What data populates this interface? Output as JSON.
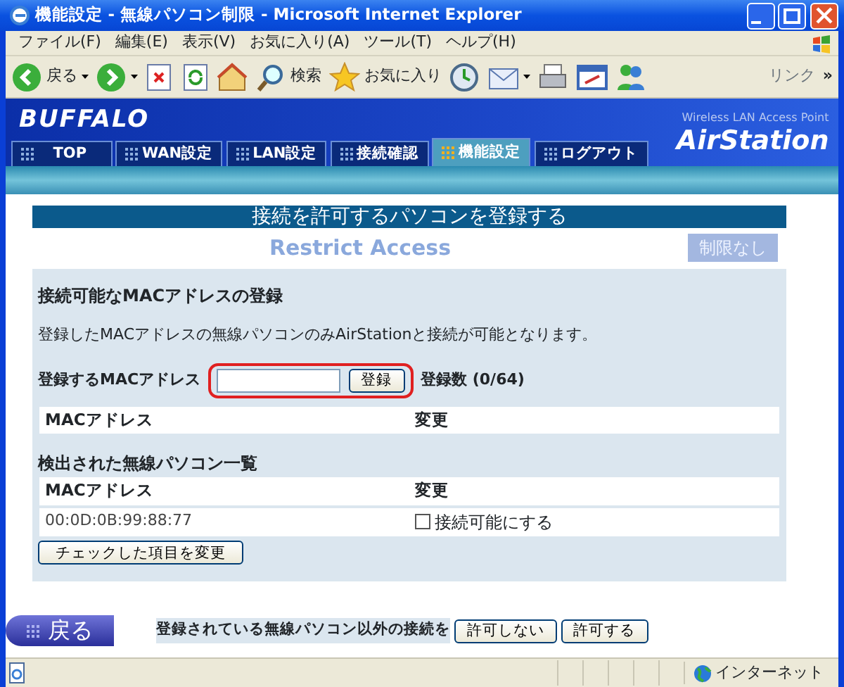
{
  "window": {
    "title": "機能設定 - 無線パソコン制限 - Microsoft Internet Explorer"
  },
  "menu": [
    "ファイル(F)",
    "編集(E)",
    "表示(V)",
    "お気に入り(A)",
    "ツール(T)",
    "ヘルプ(H)"
  ],
  "toolbar": [
    {
      "kind": "back",
      "label": "戻る"
    },
    {
      "kind": "forward"
    },
    {
      "kind": "stop"
    },
    {
      "kind": "refresh"
    },
    {
      "kind": "home"
    },
    {
      "kind": "search",
      "label": "検索"
    },
    {
      "kind": "favorites",
      "label": "お気に入り"
    },
    {
      "kind": "history"
    },
    {
      "kind": "mail"
    },
    {
      "kind": "print"
    },
    {
      "kind": "edit"
    },
    {
      "kind": "messenger"
    }
  ],
  "links_label": "リンク",
  "links_chevron": "»",
  "banner": {
    "logo": "BUFFALO",
    "tagline": "Wireless LAN Access Point",
    "brand": "AirStation",
    "tabs": [
      {
        "label": "TOP",
        "selected": false
      },
      {
        "label": "WAN設定",
        "selected": false
      },
      {
        "label": "LAN設定",
        "selected": false
      },
      {
        "label": "接続確認",
        "selected": false
      },
      {
        "label": "機能設定",
        "selected": true
      },
      {
        "label": "ログアウト",
        "selected": false
      }
    ]
  },
  "page": {
    "heading": "接続を許可するパソコンを登録する",
    "subtitle": "Restrict Access",
    "top_button": {
      "label": "制限なし",
      "disabled": true
    },
    "register": {
      "title": "接続可能なMACアドレスの登録",
      "description": "登録したMACアドレスの無線パソコンのみAirStationと接続が可能となります。",
      "field_label": "登録するMACアドレス",
      "button": "登録",
      "count": "登録数 (0/64)",
      "highlighted": true,
      "columns": [
        "MACアドレス",
        "変更"
      ]
    },
    "detected": {
      "title": "検出された無線パソコン一覧",
      "columns": [
        "MACアドレス",
        "変更"
      ],
      "rows": [
        {
          "mac": "00:0D:0B:99:88:77",
          "option": "接続可能にする",
          "checked": false
        }
      ],
      "button": "チェックした項目を変更"
    },
    "back": "戻る",
    "other_label": "登録されている無線パソコン以外の接続を",
    "other_buttons": [
      "許可しない",
      "許可する"
    ]
  },
  "status_bar": {
    "zone": "インターネット"
  }
}
